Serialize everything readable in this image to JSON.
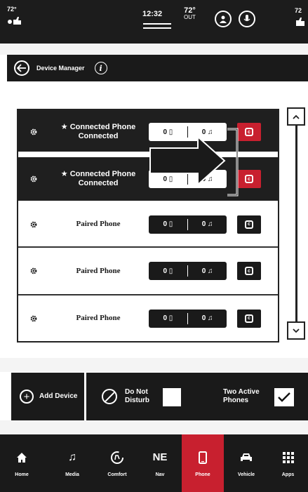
{
  "status_bar": {
    "left_temp": "72°",
    "time": "12:32",
    "outside_temp": "72°",
    "outside_label": "OUT",
    "right_temp": "72"
  },
  "header": {
    "title": "Device Manager"
  },
  "devices": [
    {
      "name_line1": "★ Connected Phone",
      "name_line2": "Connected",
      "state": "connected",
      "pill_left": "0 ▯",
      "pill_right": "0 ♫"
    },
    {
      "name_line1": "★ Connected Phone",
      "name_line2": "Connected",
      "state": "connected",
      "pill_left": "0 ▯",
      "pill_right": "0 ♫"
    },
    {
      "name_line1": "Paired Phone",
      "name_line2": "",
      "state": "paired",
      "pill_left": "0 ▯",
      "pill_right": "0 ♫"
    },
    {
      "name_line1": "Paired Phone",
      "name_line2": "",
      "state": "paired",
      "pill_left": "0 ▯",
      "pill_right": "0 ♫"
    },
    {
      "name_line1": "Paired Phone",
      "name_line2": "",
      "state": "paired",
      "pill_left": "0 ▯",
      "pill_right": "0 ♫"
    }
  ],
  "actions": {
    "add_device": "Add Device",
    "do_not_disturb_1": "Do Not",
    "do_not_disturb_2": "Disturb",
    "do_not_disturb_checked": false,
    "two_active_1": "Two Active",
    "two_active_2": "Phones",
    "two_active_checked": true
  },
  "nav": [
    {
      "label": "Home",
      "icon": "home-icon",
      "active": false
    },
    {
      "label": "Media",
      "icon": "music-note-icon",
      "active": false
    },
    {
      "label": "Comfort",
      "icon": "comfort-icon",
      "active": false
    },
    {
      "label": "Nav",
      "icon": "compass-icon",
      "active": false,
      "icon_text": "NE"
    },
    {
      "label": "Phone",
      "icon": "phone-icon",
      "active": true
    },
    {
      "label": "Vehicle",
      "icon": "car-icon",
      "active": false
    },
    {
      "label": "Apps",
      "icon": "apps-grid-icon",
      "active": false
    }
  ],
  "colors": {
    "accent_red": "#c8202f",
    "dark": "#1a1a1a",
    "background": "#ffffff"
  }
}
